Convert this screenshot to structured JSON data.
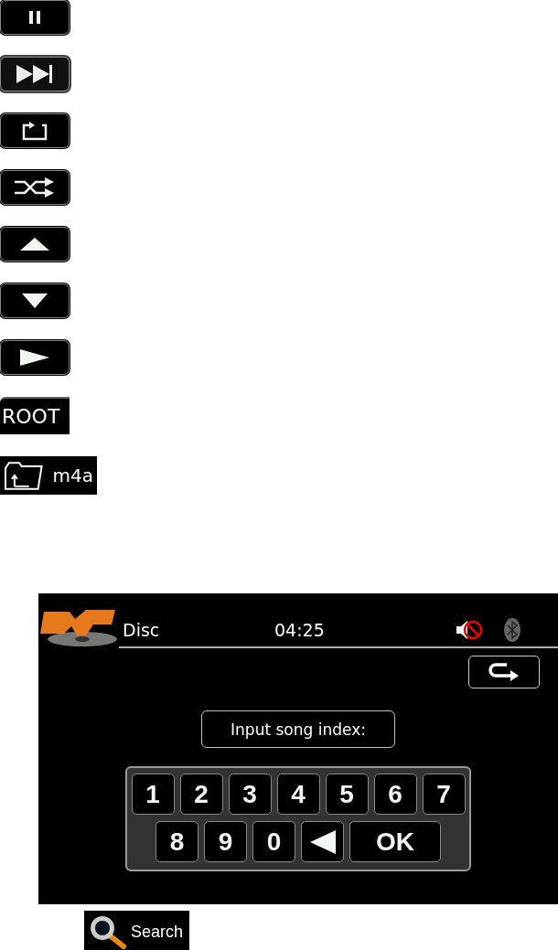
{
  "icon_buttons": [
    {
      "kind": "pause"
    },
    {
      "kind": "next"
    },
    {
      "kind": "repeat"
    },
    {
      "kind": "shuffle"
    },
    {
      "kind": "up"
    },
    {
      "kind": "down"
    },
    {
      "kind": "play"
    }
  ],
  "root_button": {
    "label": "ROOT"
  },
  "folder_button": {
    "label": "m4a"
  },
  "screen": {
    "source": "Disc",
    "time": "04:25",
    "muted": true,
    "prompt": "Input song index:",
    "keys": [
      [
        {
          "kind": "digit",
          "label": "1"
        },
        {
          "kind": "digit",
          "label": "2"
        },
        {
          "kind": "digit",
          "label": "3"
        },
        {
          "kind": "digit",
          "label": "4"
        },
        {
          "kind": "digit",
          "label": "5"
        },
        {
          "kind": "digit",
          "label": "6"
        },
        {
          "kind": "digit",
          "label": "7"
        }
      ],
      [
        {
          "kind": "digit",
          "label": "8"
        },
        {
          "kind": "digit",
          "label": "9"
        },
        {
          "kind": "digit",
          "label": "0"
        },
        {
          "kind": "backspace"
        },
        {
          "kind": "ok",
          "label": "OK"
        }
      ]
    ]
  },
  "search_button": {
    "label": "Search"
  }
}
